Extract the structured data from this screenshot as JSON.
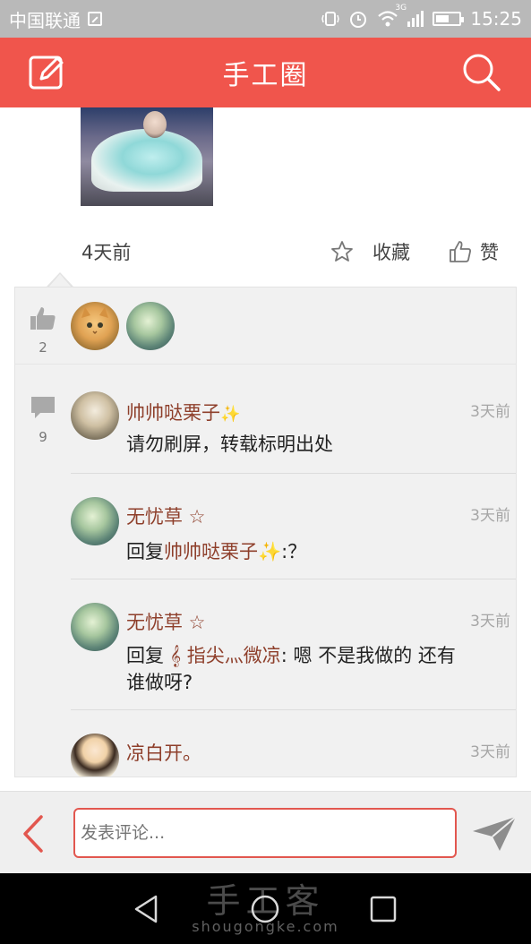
{
  "status_bar": {
    "carrier": "中国联通",
    "network": "3G",
    "time": "15:25"
  },
  "app_bar": {
    "title": "手工圈",
    "left_icon": "edit-icon",
    "right_icon": "search-icon"
  },
  "post": {
    "time": "4天前",
    "favorite_label": "收藏",
    "like_label": "赞"
  },
  "likes": {
    "count": "2",
    "avatars": [
      "cat-avatar",
      "moon-avatar"
    ]
  },
  "comments_section": {
    "count": "9",
    "items": [
      {
        "name": "帅帅哒栗子",
        "badge": "✨",
        "time": "3天前",
        "text": "请勿刷屏，转载标明出处",
        "avatar": "doll-avatar"
      },
      {
        "name": "无忧草 ☆",
        "time": "3天前",
        "prefix": "回复",
        "reply_to": "帅帅哒栗子✨",
        "text": ":？",
        "avatar": "moon-avatar"
      },
      {
        "name": "无忧草 ☆",
        "time": "3天前",
        "prefix": "回复",
        "reply_to": "𝄞 指尖灬微凉",
        "text": ": 嗯   不是我做的 还有谁做呀?",
        "avatar": "moon-avatar"
      },
      {
        "name": "凉白开。",
        "time": "3天前",
        "avatar": "girl-avatar"
      }
    ]
  },
  "comment_input": {
    "placeholder": "发表评论..."
  },
  "watermark": {
    "chinese": "手工客",
    "domain": "shougongke.com"
  }
}
